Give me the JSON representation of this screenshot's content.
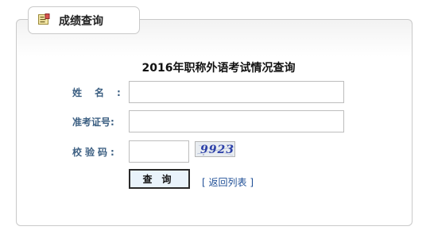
{
  "tab": {
    "title": "成绩查询",
    "icon": "report-card-icon"
  },
  "form": {
    "heading": "2016年职称外语考试情况查询",
    "name_label": "姓名",
    "id_label": "准考证号:",
    "code_label": "校验码:",
    "colon": ":",
    "name_value": "",
    "id_value": "",
    "code_value": "",
    "captcha_text": "9923",
    "submit_label": "查询",
    "back_label": "返回列表",
    "bracket_open": "[",
    "bracket_close": "]"
  }
}
